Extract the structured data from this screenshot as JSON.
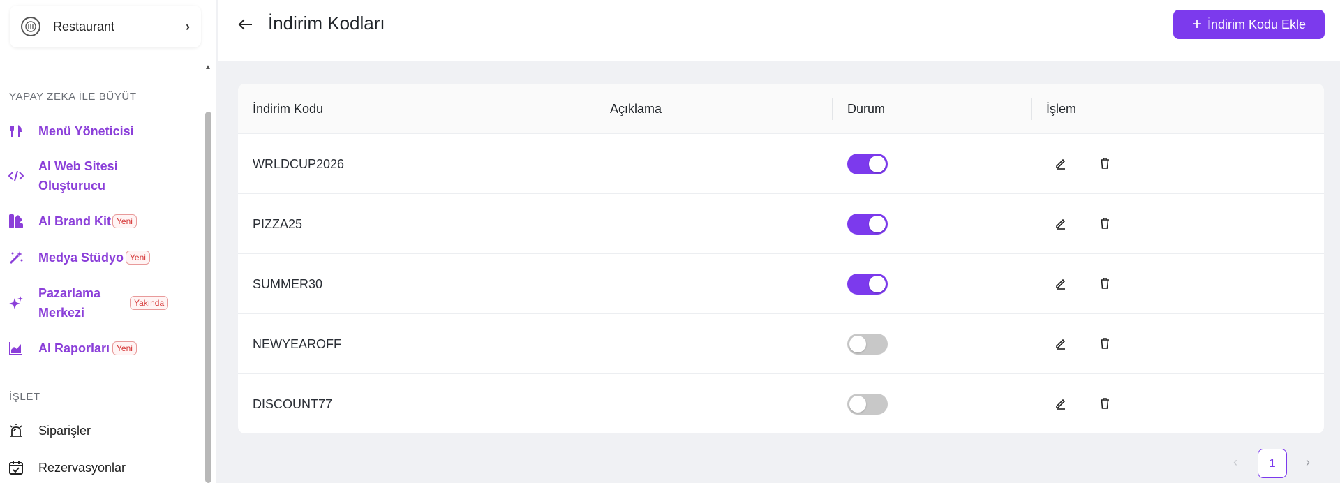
{
  "sidebar": {
    "restaurant": {
      "name": "Restaurant",
      "chevron": "›"
    },
    "sections": [
      {
        "title": "YAPAY ZEKA İLE BÜYÜT"
      },
      {
        "title": "İŞLET"
      }
    ],
    "items": [
      {
        "label": "Menü Yöneticisi",
        "icon": "utensils-icon"
      },
      {
        "label": "AI Web Sitesi",
        "label2": "Oluşturucu",
        "icon": "code-icon"
      },
      {
        "label": "AI Brand Kit",
        "badge": "Yeni",
        "icon": "palette-icon"
      },
      {
        "label": "Medya Stüdyo",
        "badge": "Yeni",
        "icon": "magic-wand-icon"
      },
      {
        "label": "Pazarlama",
        "label2": "Merkezi",
        "badge": "Yakında",
        "icon": "sparkles-icon"
      },
      {
        "label": "AI Raporları",
        "badge": "Yeni",
        "icon": "chart-area-icon"
      },
      {
        "label": "Siparişler",
        "icon": "alarm-bell-icon"
      },
      {
        "label": "Rezervasyonlar",
        "icon": "calendar-check-icon"
      }
    ]
  },
  "header": {
    "title": "İndirim Kodları",
    "add_button": "İndirim Kodu Ekle",
    "add_icon": "+"
  },
  "table": {
    "columns": [
      "İndirim Kodu",
      "Açıklama",
      "Durum",
      "İşlem"
    ],
    "rows": [
      {
        "code": "WRLDCUP2026",
        "description": "",
        "active": true
      },
      {
        "code": "PIZZA25",
        "description": "",
        "active": true
      },
      {
        "code": "SUMMER30",
        "description": "",
        "active": true
      },
      {
        "code": "NEWYEAROFF",
        "description": "",
        "active": false
      },
      {
        "code": "DISCOUNT77",
        "description": "",
        "active": false
      }
    ]
  },
  "pagination": {
    "prev": "‹",
    "current": "1",
    "next": "›"
  },
  "colors": {
    "accent": "#7c3aed",
    "nav_purple": "#8b3fd9",
    "badge_red": "#d63a3a"
  }
}
